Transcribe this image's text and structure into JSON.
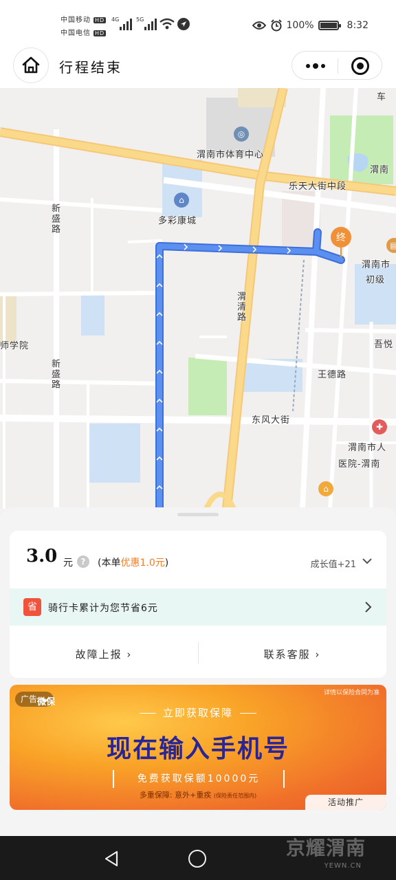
{
  "status_bar": {
    "carrier1": "中国移动",
    "carrier2": "中国电信",
    "hd": "HD",
    "net1": "4G",
    "net2": "5G",
    "battery_pct": "100%",
    "battery_level": 1.0,
    "time": "8:32"
  },
  "header": {
    "title": "行程结束"
  },
  "map": {
    "labels": {
      "sports_center": "渭南市体育中心",
      "letian": "乐天大街中段",
      "weinan_right": "渭南",
      "duocai": "多彩康城",
      "xinsheng1": "新盛路",
      "xinsheng2": "新盛路",
      "weiqing": "渭清路",
      "weinan_school": "渭南市",
      "chuji": "初级",
      "xueyuan": "师学院",
      "wude": "王德路",
      "wuyue": "吾悦",
      "dongfeng": "东风大街",
      "hospital1": "渭南市人",
      "hospital2": "医院-渭南",
      "che": "车",
      "end_marker": "终"
    },
    "colors": {
      "route": "#5b8ff0",
      "road_main": "#fbd98b",
      "green": "#c4ecb4",
      "water": "#b7d6f4",
      "end": "#f0913a"
    }
  },
  "trip": {
    "price": "3.0",
    "unit": "元",
    "help": "?",
    "discount_prefix": "(本单",
    "discount_value": "优惠1.0元",
    "discount_suffix": ")",
    "growth": "成长值+21",
    "savings_badge": "省",
    "savings_text": "骑行卡累计为您节省6元",
    "report_fault": "故障上报 ›",
    "contact_service": "联系客服 ›"
  },
  "ad": {
    "tag": "广告",
    "brand": "微保",
    "corner_note": "详情以保险合同为准",
    "subtitle": "立即获取保障",
    "title": "现在输入手机号",
    "offer": "免费获取保额10000元",
    "footer": "多重保障: 意外+重疾",
    "footer_small": "(保险责任范围内)",
    "promo": "活动推广"
  },
  "watermark": {
    "text": "京耀渭南",
    "url": "YEWN.CN"
  }
}
